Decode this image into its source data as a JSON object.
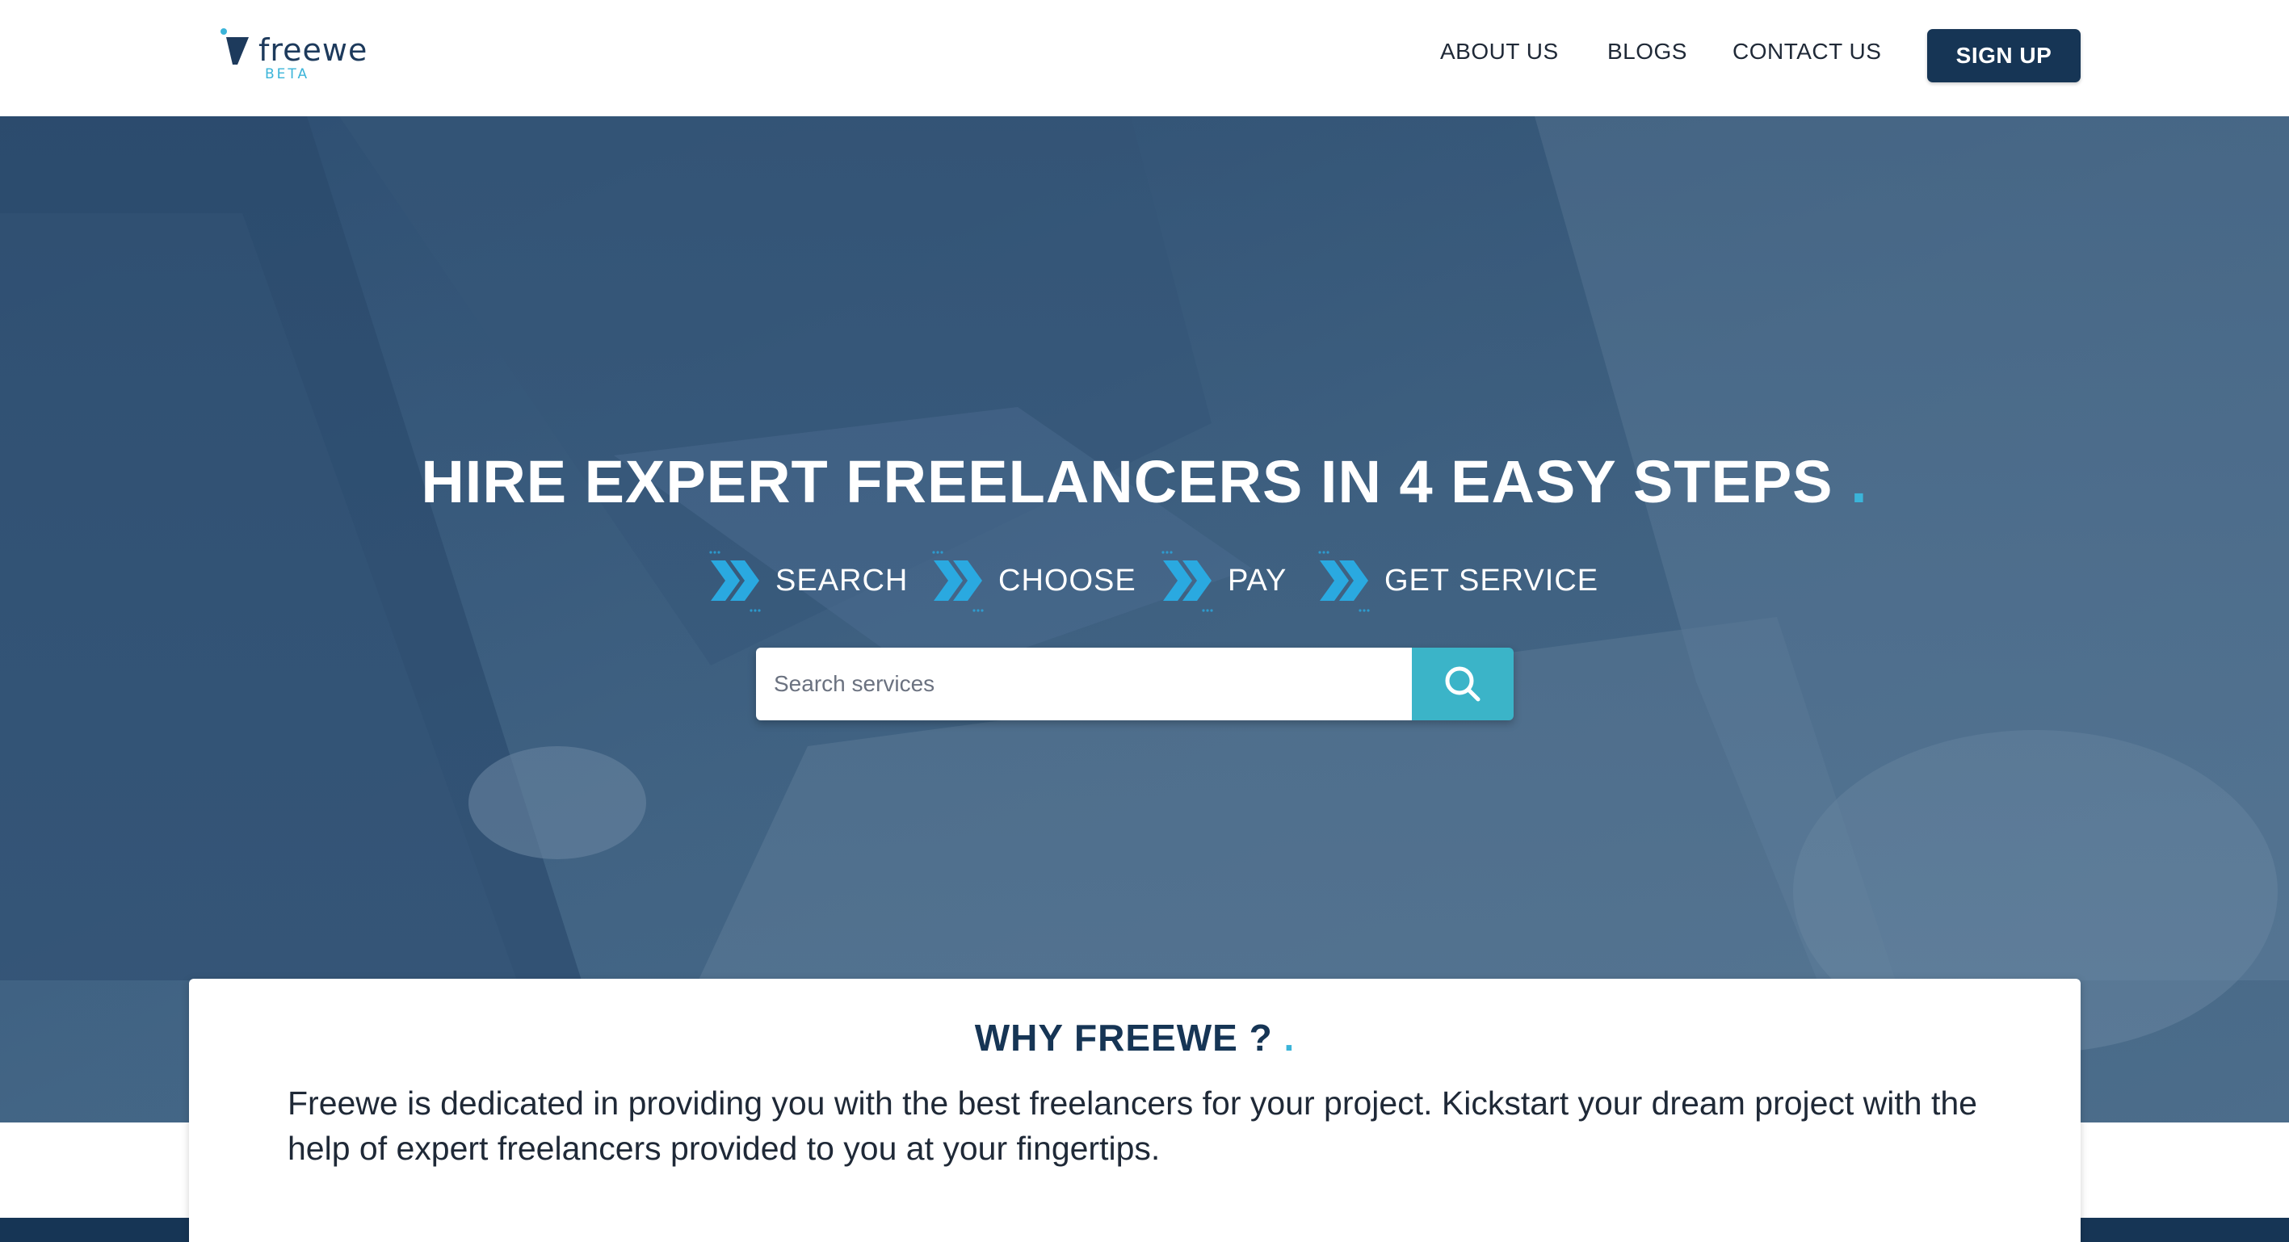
{
  "header": {
    "logo_word": "freewe",
    "logo_badge": "BETA",
    "nav": [
      "ABOUT US",
      "BLOGS",
      "CONTACT US"
    ],
    "signup_label": "SIGN UP"
  },
  "hero": {
    "title": "HIRE EXPERT FREELANCERS IN 4 EASY STEPS",
    "title_dot": ".",
    "steps": [
      "SEARCH",
      "CHOOSE",
      "PAY",
      "GET SERVICE"
    ],
    "search_placeholder": "Search services",
    "search_icon": "search-icon"
  },
  "why": {
    "title": "WHY FREEWE ?",
    "title_dot": ".",
    "text": "Freewe is dedicated in providing you with the best freelancers for your project. Kickstart your dream project with the help of expert freelancers provided to you at your fingertips."
  },
  "colors": {
    "brand_dark": "#163555",
    "accent": "#3bb4d9",
    "search_button": "#3bb4c8"
  }
}
